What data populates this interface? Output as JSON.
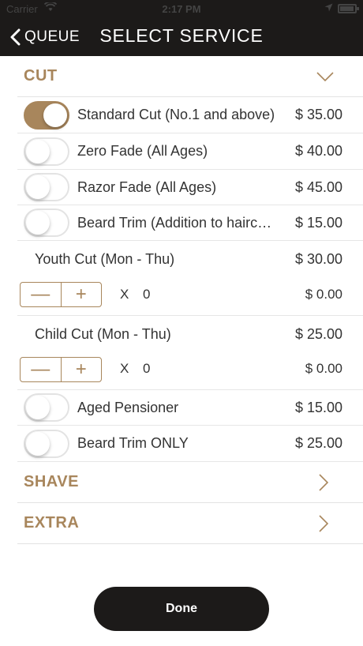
{
  "status_bar": {
    "carrier": "Carrier",
    "time": "2:17 PM"
  },
  "nav": {
    "back_label": "QUEUE",
    "title": "SELECT SERVICE"
  },
  "sections": {
    "cut": {
      "title": "CUT",
      "expanded": true
    },
    "shave": {
      "title": "SHAVE",
      "expanded": false
    },
    "extra": {
      "title": "EXTRA",
      "expanded": false
    }
  },
  "toggle_items": [
    {
      "name": "Standard Cut (No.1 and above)",
      "price": "$ 35.00",
      "on": true
    },
    {
      "name": "Zero Fade (All Ages)",
      "price": "$ 40.00",
      "on": false
    },
    {
      "name": "Razor Fade (All Ages)",
      "price": "$ 45.00",
      "on": false
    },
    {
      "name": "Beard Trim (Addition to hairc…",
      "price": "$ 15.00",
      "on": false
    }
  ],
  "quantity_items": [
    {
      "name": "Youth Cut (Mon - Thu)",
      "price": "$ 30.00",
      "x": "X",
      "count": "0",
      "total": "$ 0.00"
    },
    {
      "name": "Child Cut (Mon - Thu)",
      "price": "$ 25.00",
      "x": "X",
      "count": "0",
      "total": "$ 0.00"
    }
  ],
  "toggle_items_2": [
    {
      "name": "Aged Pensioner",
      "price": "$ 15.00",
      "on": false
    },
    {
      "name": "Beard Trim ONLY",
      "price": "$ 25.00",
      "on": false
    }
  ],
  "done_label": "Done",
  "colors": {
    "accent": "#a8865c",
    "dark": "#1c1a19"
  }
}
